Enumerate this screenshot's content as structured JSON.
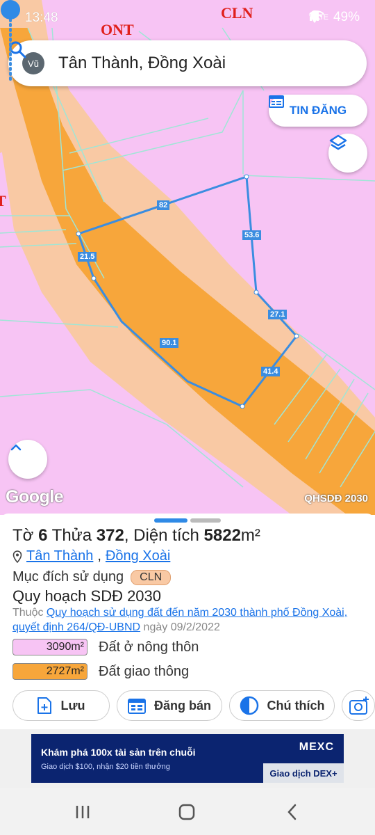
{
  "status_bar": {
    "time": "13:48",
    "battery": "49%",
    "network": "VoLTE"
  },
  "map": {
    "zone_labels": [
      "ONT",
      "CLN",
      "T"
    ],
    "edge_labels": [
      "82",
      "53.6",
      "21.5",
      "27.1",
      "90.1",
      "41.4"
    ],
    "layer_name": "QHSDĐ 2030",
    "google_logo": "Google",
    "colors": {
      "rural_residential": "#f7c4f4",
      "traffic": "#f7a63b",
      "perennial": "#f9c9a4",
      "boundary": "#3b8de0"
    }
  },
  "search": {
    "avatar": "Vũ",
    "query": "Tân Thành, Đồng Xoài",
    "icon": "search-icon"
  },
  "buttons": {
    "listing": "TIN ĐĂNG",
    "layers_icon": "layers-icon",
    "up_icon": "chevron-up-icon"
  },
  "sheet": {
    "title_prefix": "Tờ",
    "sheet_no": "6",
    "parcel_prefix": "Thửa",
    "parcel_no": "372",
    "area_prefix": ", Diện tích",
    "area_value": "5822",
    "area_unit": "m²",
    "ward": "Tân Thành",
    "separator": ",",
    "city": "Đồng Xoài",
    "purpose_label": "Mục đích sử dụng",
    "purpose_code": "CLN",
    "plan_title": "Quy hoạch SDĐ 2030",
    "plan_prefix": "Thuộc",
    "plan_link": "Quy hoạch sử dụng đất đến năm 2030 thành phố Đồng Xoài, quyết định 264/QĐ-UBND",
    "plan_suffix": "ngày 09/2/2022",
    "legend": [
      {
        "area": "3090m²",
        "label": "Đất ở nông thôn",
        "color": "#f7c4f4"
      },
      {
        "area": "2727m²",
        "label": "Đất giao thông",
        "color": "#f7a63b"
      }
    ],
    "actions": [
      {
        "label": "Lưu",
        "icon": "add-file-icon"
      },
      {
        "label": "Đăng bán",
        "icon": "calendar-icon"
      },
      {
        "label": "Chú thích",
        "icon": "contrast-icon"
      },
      {
        "label": "",
        "icon": "add-photo-icon"
      }
    ]
  },
  "ad": {
    "title": "Khám phá 100x tài sản trên chuỗi",
    "subtitle": "Giao dịch $100, nhận $20 tiền thưởng",
    "brand": "MEXC",
    "cta": "Giao dịch DEX+"
  }
}
